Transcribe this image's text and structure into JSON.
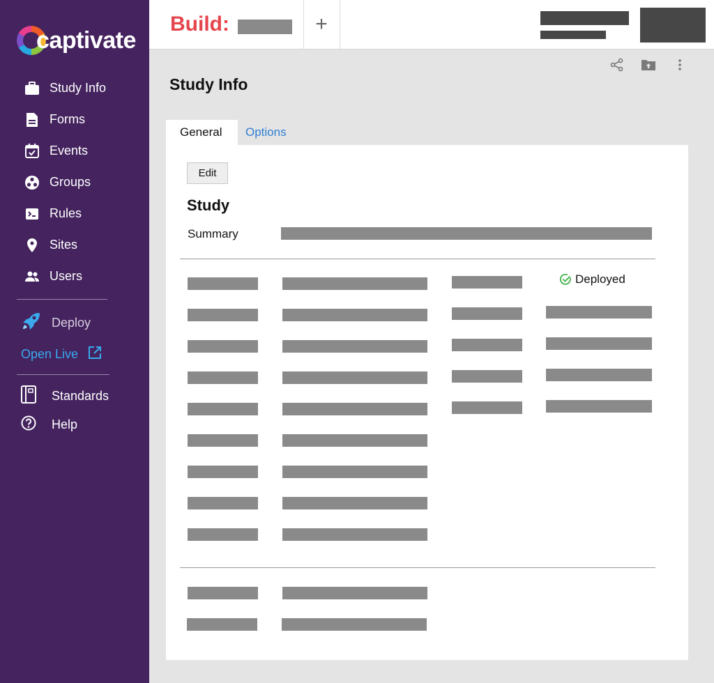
{
  "app": {
    "brand": "captivate",
    "build_label": "Build:",
    "add_label": "+"
  },
  "sidebar": {
    "items": [
      {
        "label": "Study Info",
        "icon": "briefcase-icon"
      },
      {
        "label": "Forms",
        "icon": "document-icon"
      },
      {
        "label": "Events",
        "icon": "calendar-check-icon"
      },
      {
        "label": "Groups",
        "icon": "groups-icon"
      },
      {
        "label": "Rules",
        "icon": "terminal-icon"
      },
      {
        "label": "Sites",
        "icon": "location-pin-icon"
      },
      {
        "label": "Users",
        "icon": "users-icon"
      }
    ],
    "deploy_label": "Deploy",
    "open_live_label": "Open Live",
    "standards_label": "Standards",
    "help_label": "Help"
  },
  "toolbar": {
    "icons": [
      "share-icon",
      "folder-upload-icon",
      "more-vertical-icon"
    ]
  },
  "page": {
    "title": "Study Info",
    "tabs": [
      {
        "label": "General",
        "active": true
      },
      {
        "label": "Options",
        "active": false
      }
    ]
  },
  "study": {
    "edit_label": "Edit",
    "section_title": "Study",
    "summary_label": "Summary",
    "status_label": "Deployed"
  },
  "colors": {
    "sidebar_bg": "#44235e",
    "brand_red": "#e5454c",
    "link_blue": "#2f7fd4",
    "live_blue": "#3aa9ee",
    "deployed_green": "#3cb043",
    "redaction_gray": "#8a8a8a"
  }
}
